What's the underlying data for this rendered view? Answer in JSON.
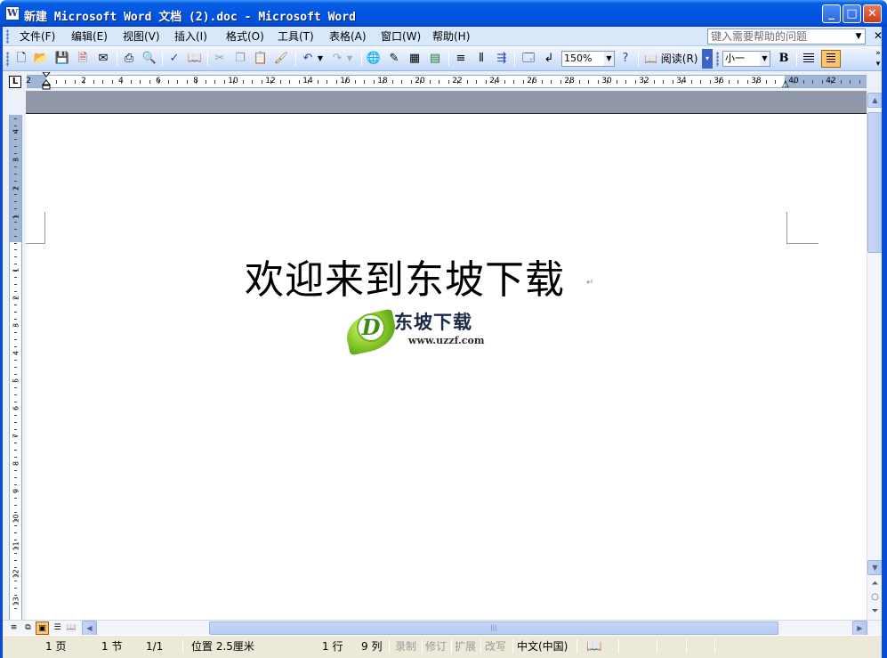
{
  "window": {
    "title": "新建 Microsoft Word 文档 (2).doc - Microsoft Word",
    "app_icon": "W"
  },
  "menubar": {
    "items": [
      "文件(F)",
      "编辑(E)",
      "视图(V)",
      "插入(I)",
      "格式(O)",
      "工具(T)",
      "表格(A)",
      "窗口(W)",
      "帮助(H)"
    ],
    "help_placeholder": "键入需要帮助的问题"
  },
  "toolbar": {
    "zoom": "150%",
    "read_label": "阅读(R)",
    "font_size": "小一",
    "bold_label": "B",
    "icons": [
      "new-doc-icon",
      "open-folder-icon",
      "save-icon",
      "permission-icon",
      "email-icon",
      "print-icon",
      "print-preview-icon",
      "spelling-icon",
      "research-icon",
      "cut-icon",
      "copy-icon",
      "paste-icon",
      "format-painter-icon",
      "undo-icon",
      "redo-icon",
      "hyperlink-icon",
      "tables-borders-icon",
      "insert-table-icon",
      "insert-excel-icon",
      "columns-icon",
      "drawing-icon",
      "document-map-icon",
      "show-hide-icon",
      "help-icon"
    ]
  },
  "ruler": {
    "h_numbers": [
      "2",
      "2",
      "4",
      "6",
      "8",
      "10",
      "12",
      "14",
      "16",
      "18",
      "20",
      "22",
      "24",
      "26",
      "28",
      "30",
      "32",
      "34",
      "36",
      "38",
      "40",
      "42"
    ],
    "v_numbers_top": [
      "4",
      "3",
      "2",
      "1"
    ],
    "v_numbers": [
      "1",
      "2",
      "3",
      "4",
      "5",
      "6",
      "7",
      "8",
      "9",
      "10",
      "11",
      "12",
      "13"
    ],
    "tab_selector": "L"
  },
  "document": {
    "title": "欢迎来到东坡下载",
    "logo_name": "东坡下载",
    "logo_url": "www.uzzf.com",
    "logo_letter": "D"
  },
  "statusbar": {
    "page": "1 页",
    "section": "1 节",
    "page_of": "1/1",
    "position": "位置 2.5厘米",
    "line": "1 行",
    "column": "9 列",
    "rec": "录制",
    "trk": "修订",
    "ext": "扩展",
    "ovr": "改写",
    "language": "中文(中国)"
  },
  "colors": {
    "titlebar": "#0054e3",
    "toolbar": "#c4d9f8",
    "active_button": "#f9c66f"
  }
}
